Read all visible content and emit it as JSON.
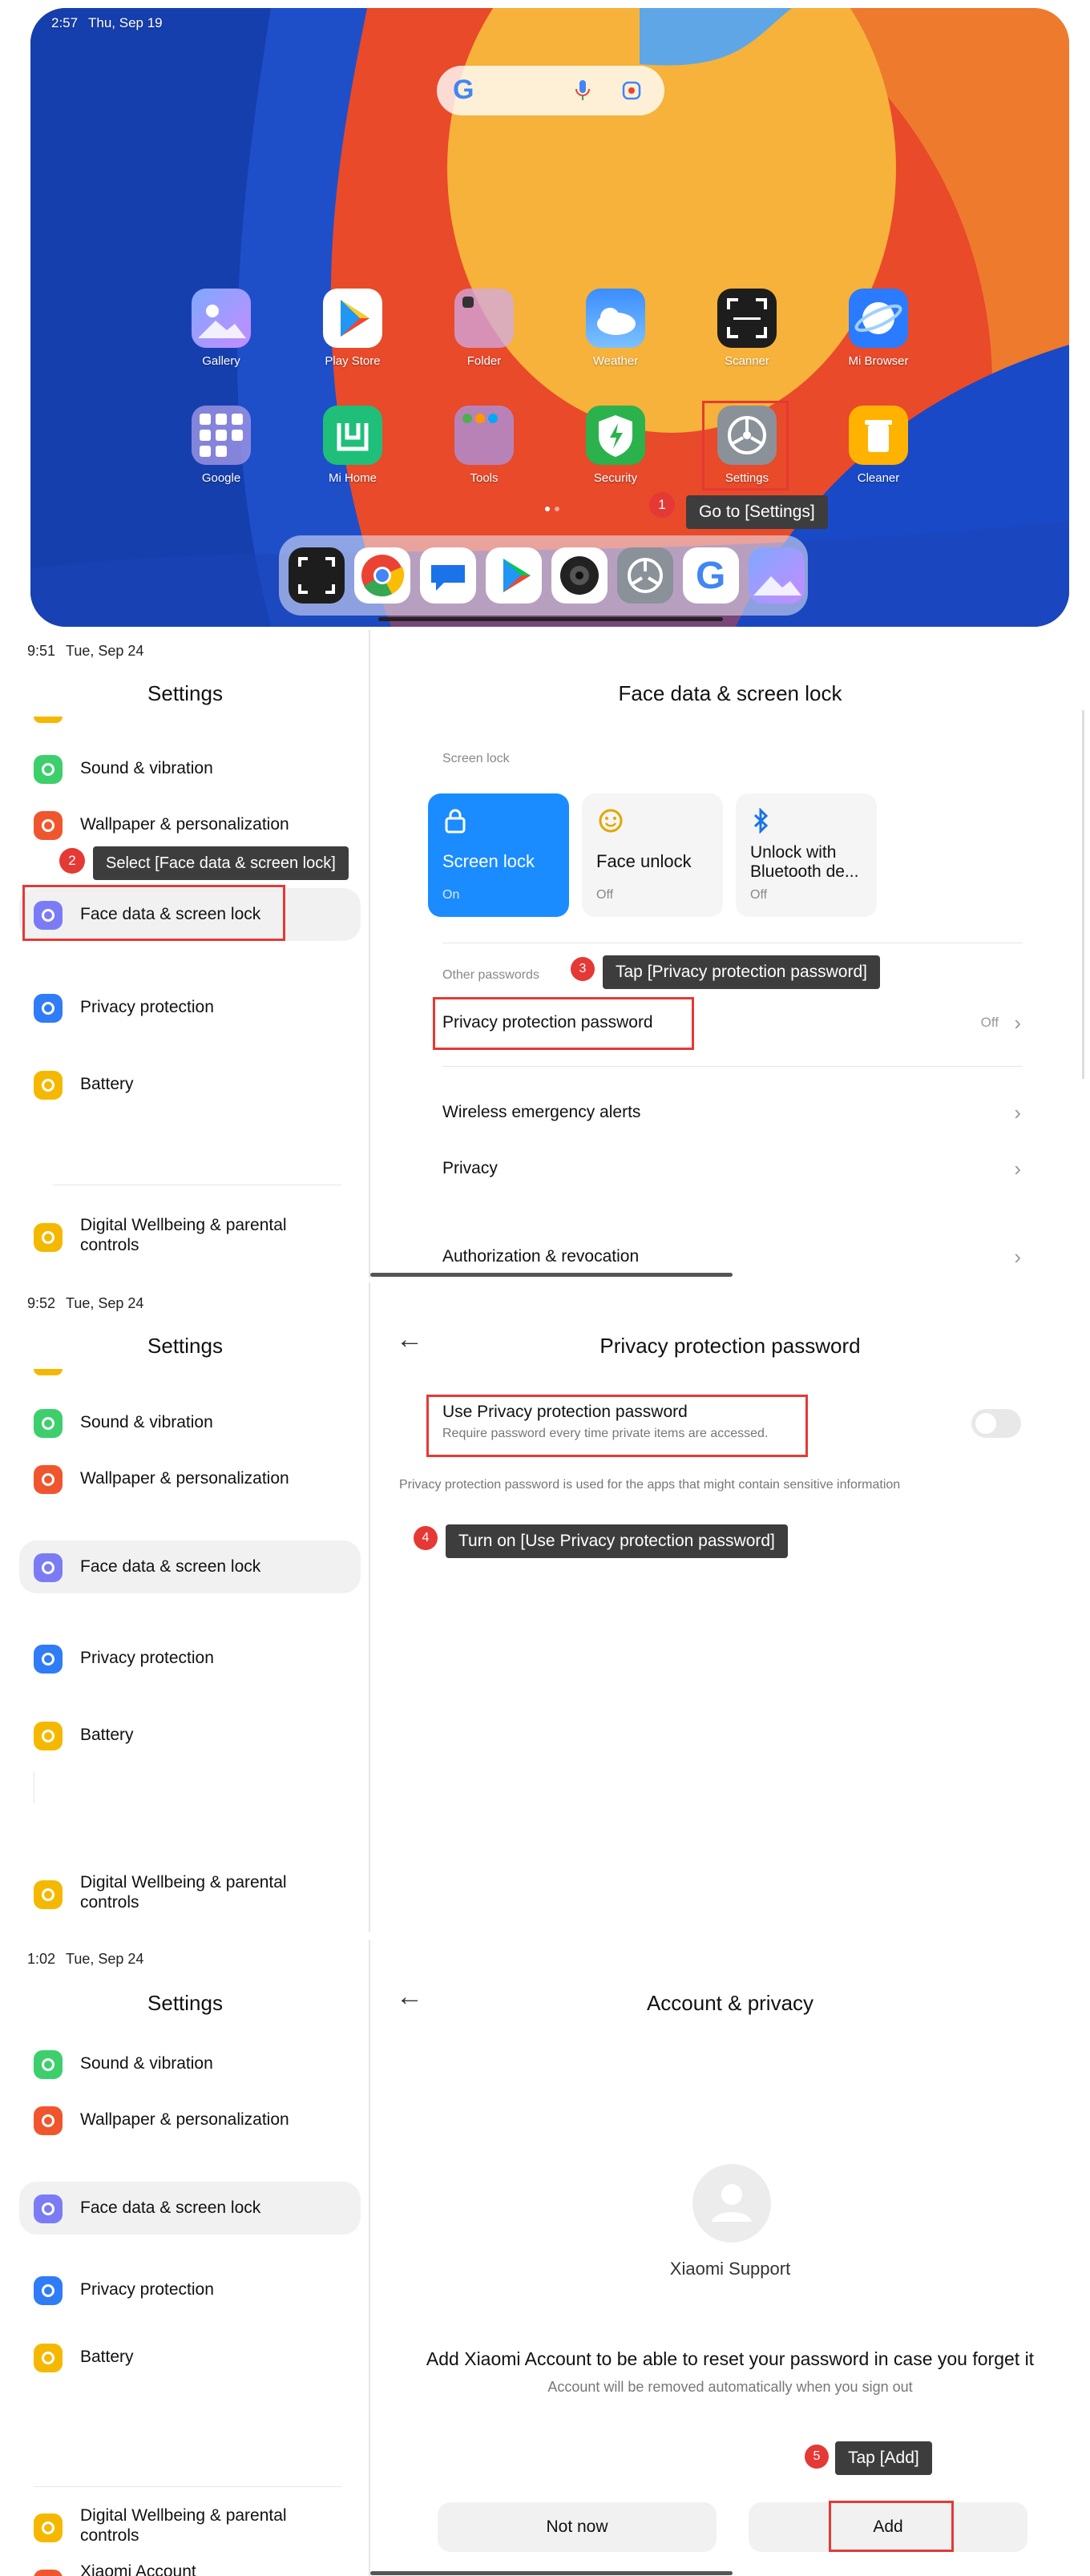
{
  "home": {
    "status_time": "2:57",
    "status_date": "Thu, Sep 19",
    "apps_row1": [
      "Gallery",
      "Play Store",
      "Folder",
      "Weather",
      "Scanner",
      "Mi Browser"
    ],
    "apps_row2": [
      "Google",
      "Mi Home",
      "Tools",
      "Security",
      "Settings",
      "Cleaner"
    ],
    "dock_icons": [
      "scanner-icon",
      "chrome-icon",
      "messages-icon",
      "play-store-icon",
      "camera-icon",
      "settings-icon",
      "google-icon",
      "gallery-icon"
    ]
  },
  "annotations": {
    "step1_num": "1",
    "step1": "Go to [Settings]",
    "step2_num": "2",
    "step2": "Select [Face data & screen lock]",
    "step3_num": "3",
    "step3": "Tap [Privacy protection password]",
    "step4_num": "4",
    "step4": "Turn on [Use Privacy protection password]",
    "step5_num": "5",
    "step5": "Tap [Add]"
  },
  "panel1": {
    "status_time": "9:51",
    "status_date": "Tue, Sep 24",
    "left_title": "Settings",
    "left_items": [
      "Sound & vibration",
      "Wallpaper & personalization",
      "Face data & screen lock",
      "Privacy protection",
      "Battery",
      "Digital Wellbeing & parental controls"
    ],
    "right_title": "Face data & screen lock",
    "section_screen_lock": "Screen lock",
    "cards": [
      {
        "title": "Screen lock",
        "status": "On"
      },
      {
        "title": "Face unlock",
        "status": "Off"
      },
      {
        "title": "Unlock with Bluetooth de...",
        "status": "Off"
      }
    ],
    "section_other": "Other passwords",
    "privacy_password_label": "Privacy protection password",
    "privacy_password_value": "Off",
    "rows": [
      "Wireless emergency alerts",
      "Privacy",
      "Authorization & revocation"
    ]
  },
  "panel2": {
    "status_time": "9:52",
    "status_date": "Tue, Sep 24",
    "left_title": "Settings",
    "left_items": [
      "Sound & vibration",
      "Wallpaper & personalization",
      "Face data & screen lock",
      "Privacy protection",
      "Battery",
      "Digital Wellbeing & parental controls"
    ],
    "right_title": "Privacy protection password",
    "toggle_title": "Use Privacy protection password",
    "toggle_sub": "Require password every time private items are accessed.",
    "toggle_on": false,
    "info": "Privacy protection password is used for the apps that might contain sensitive information"
  },
  "panel3": {
    "status_time": "1:02",
    "status_date": "Tue, Sep 24",
    "left_title": "Settings",
    "left_items": [
      "Sound & vibration",
      "Wallpaper & personalization",
      "Face data & screen lock",
      "Privacy protection",
      "Battery",
      "Digital Wellbeing & parental controls",
      "Xiaomi Account"
    ],
    "right_title": "Account & privacy",
    "account_name": "Xiaomi Support",
    "message": "Add Xiaomi Account to be able to reset your password in case you forget it",
    "sub_message": "Account will be removed automatically when you sign out",
    "btn_not_now": "Not now",
    "btn_add": "Add"
  },
  "colors": {
    "accent": "#1a8cff",
    "red": "#e53935",
    "tooltip": "#3d3d3d"
  }
}
